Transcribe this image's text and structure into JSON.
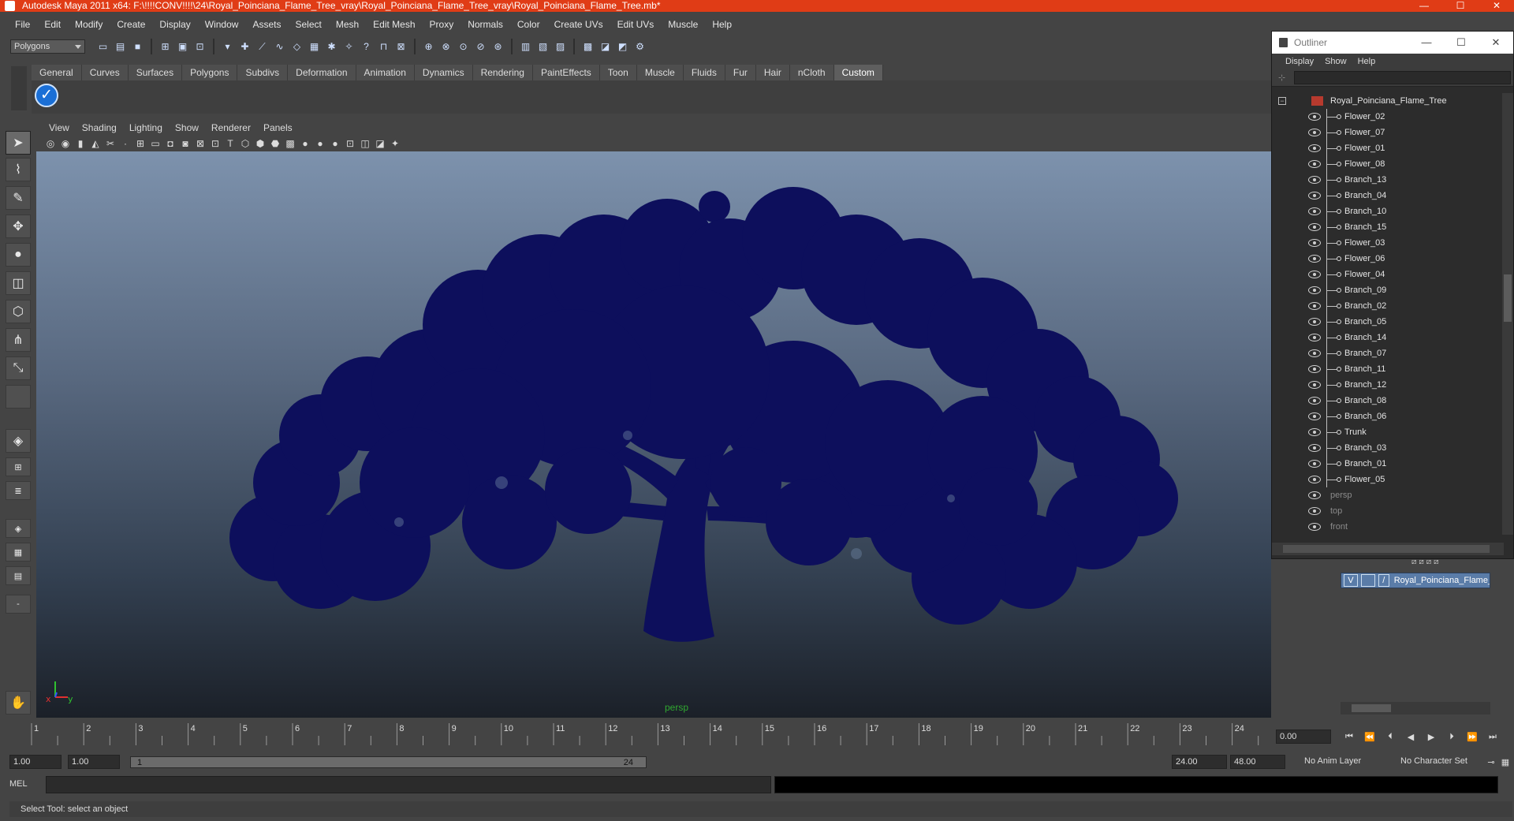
{
  "window": {
    "title": "Autodesk Maya 2011 x64: F:\\!!!!CONV!!!!\\24\\Royal_Poinciana_Flame_Tree_vray\\Royal_Poinciana_Flame_Tree_vray\\Royal_Poinciana_Flame_Tree.mb*",
    "minimize": "—",
    "maximize": "☐",
    "close": "✕"
  },
  "menubar": [
    "File",
    "Edit",
    "Modify",
    "Create",
    "Display",
    "Window",
    "Assets",
    "Select",
    "Mesh",
    "Edit Mesh",
    "Proxy",
    "Normals",
    "Color",
    "Create UVs",
    "Edit UVs",
    "Muscle",
    "Help"
  ],
  "statusline": {
    "mode": "Polygons"
  },
  "shelf": {
    "tabs": [
      "General",
      "Curves",
      "Surfaces",
      "Polygons",
      "Subdivs",
      "Deformation",
      "Animation",
      "Dynamics",
      "Rendering",
      "PaintEffects",
      "Toon",
      "Muscle",
      "Fluids",
      "Fur",
      "Hair",
      "nCloth",
      "Custom"
    ],
    "active": "Custom"
  },
  "panel_menu": [
    "View",
    "Shading",
    "Lighting",
    "Show",
    "Renderer",
    "Panels"
  ],
  "viewport": {
    "camera": "persp",
    "axis_x": "x",
    "axis_y": "y"
  },
  "timeline": {
    "ticks": [
      "1",
      "2",
      "3",
      "4",
      "5",
      "6",
      "7",
      "8",
      "9",
      "10",
      "11",
      "12",
      "13",
      "14",
      "15",
      "16",
      "17",
      "18",
      "19",
      "20",
      "21",
      "22",
      "23",
      "24"
    ],
    "current_time": "0.00"
  },
  "range": {
    "start": "1.00",
    "playback_start": "1.00",
    "slider_start": "1",
    "slider_end": "24",
    "playback_end": "24.00",
    "end": "48.00",
    "anim_layer": "No Anim Layer",
    "character_set": "No Character Set"
  },
  "command": {
    "label": "MEL"
  },
  "helpline": "Select Tool: select an object",
  "outliner": {
    "title": "Outliner",
    "menu": [
      "Display",
      "Show",
      "Help"
    ],
    "root": "Royal_Poinciana_Flame_Tree",
    "children": [
      "Flower_02",
      "Flower_07",
      "Flower_01",
      "Flower_08",
      "Branch_13",
      "Branch_04",
      "Branch_10",
      "Branch_15",
      "Flower_03",
      "Flower_06",
      "Flower_04",
      "Branch_09",
      "Branch_02",
      "Branch_05",
      "Branch_14",
      "Branch_07",
      "Branch_11",
      "Branch_12",
      "Branch_08",
      "Branch_06",
      "Trunk",
      "Branch_03",
      "Branch_01",
      "Flower_05"
    ],
    "cameras": [
      "persp",
      "top",
      "front"
    ]
  },
  "layer": {
    "visible": "V",
    "name": "Royal_Poinciana_Flame_Tree"
  },
  "colors": {
    "title_bar": "#e03c16",
    "ui_bg": "#444444",
    "tree": "#0d0f5c",
    "layer_selected": "#5a7ca8"
  }
}
